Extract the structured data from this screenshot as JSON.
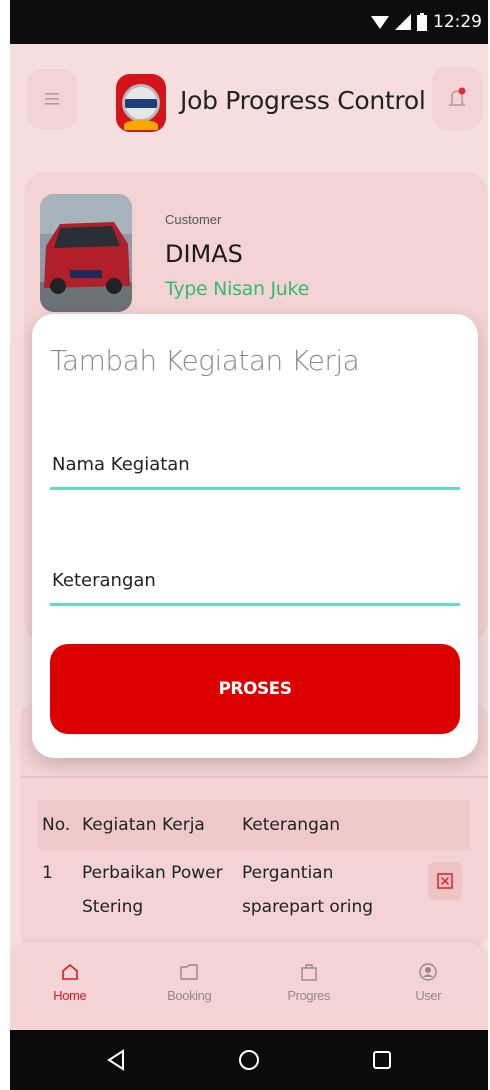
{
  "status_bar": {
    "time": "12:29"
  },
  "header": {
    "title": "Job Progress Control"
  },
  "customer": {
    "label": "Customer",
    "name": "DIMAS",
    "type": "Type Nisan Juke"
  },
  "modal": {
    "title": "Tambah Kegiatan Kerja",
    "field_nama_placeholder": "Nama Kegiatan",
    "field_keterangan_placeholder": "Keterangan",
    "submit_label": "PROSES"
  },
  "table": {
    "headers": {
      "no": "No.",
      "kegiatan": "Kegiatan Kerja",
      "keterangan": "Keterangan"
    },
    "rows": [
      {
        "no": "1",
        "kegiatan": "Perbaikan Power Stering",
        "keterangan": "Pergantian sparepart oring"
      }
    ]
  },
  "bottom_nav": {
    "items": [
      {
        "label": "Home",
        "icon": "home-icon",
        "active": true
      },
      {
        "label": "Booking",
        "icon": "folder-icon",
        "active": false
      },
      {
        "label": "Progres",
        "icon": "bag-icon",
        "active": false
      },
      {
        "label": "User",
        "icon": "user-icon",
        "active": false
      }
    ]
  },
  "colors": {
    "accent_red": "#dc0000",
    "accent_teal": "#66d9c3",
    "type_green": "#2fbf71",
    "background_pink": "#f6dede"
  }
}
